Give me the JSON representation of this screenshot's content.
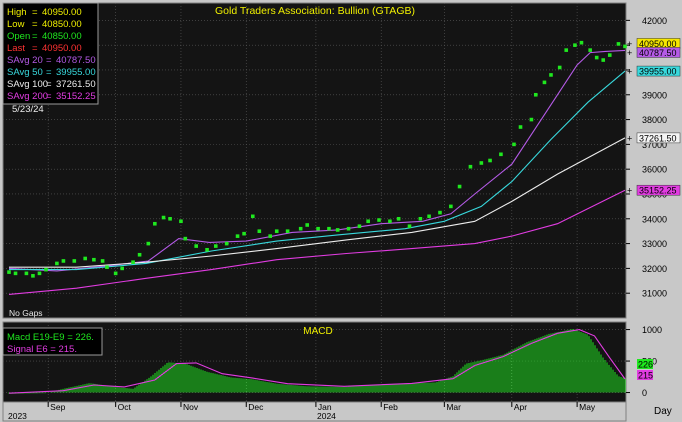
{
  "colors": {
    "background": "#141414",
    "grid": "#5a5a5a",
    "price": "#1fe81f",
    "savg20": "#b45ae6",
    "savg50": "#38d8dc",
    "savg100": "#ececec",
    "savg200": "#e13ce1",
    "high": "#f0f000",
    "low": "#f0f000",
    "open": "#1fe81f",
    "last": "#ff3232",
    "macd_bars": "#1fe81f",
    "signal": "#e13ce1",
    "title": "#f0f000",
    "last_badge": "#f5e600"
  },
  "main": {
    "title": "Gold Traders Association: Bullion (GTAGB)",
    "no_gaps": "No Gaps",
    "legend": {
      "high_label": "High",
      "high_value": "40950.00",
      "low_label": "Low",
      "low_value": "40850.00",
      "open_label": "Open",
      "open_value": "40850.00",
      "last_label": "Last",
      "last_value": "40950.00",
      "s20_label": "SAvg  20",
      "s20_value": "40787.50",
      "s50_label": "SAvg  50",
      "s50_value": "39955.00",
      "s100_label": "SAvg 100",
      "s100_value": "37261.50",
      "s200_label": "SAvg 200",
      "s200_value": "35152.25",
      "date": "5/23/24"
    },
    "badges": {
      "last": "40950.00",
      "s20": "40787.50",
      "s50": "39955.00",
      "s100": "37261.50",
      "s200": "35152.25"
    }
  },
  "macd": {
    "title": "MACD",
    "legend_macd": "Macd  E19-E9  =  226.",
    "legend_signal": "Signal  E6  =  215.",
    "badge_macd": "226",
    "badge_signal": "215"
  },
  "x_axis": {
    "year_2023": "2023",
    "year_2024": "2024",
    "months": [
      "Sep",
      "Oct",
      "Nov",
      "Dec",
      "Jan",
      "Feb",
      "Mar",
      "Apr",
      "May"
    ],
    "period": "Day"
  },
  "chart_data": [
    {
      "type": "line",
      "title": "Gold Traders Association: Bullion (GTAGB)",
      "ylim": [
        30000,
        42700
      ],
      "y_ticks": [
        31000,
        32000,
        33000,
        34000,
        35000,
        36000,
        37000,
        38000,
        39000,
        40000,
        41000,
        42000
      ],
      "x_range": [
        "2023-08-14",
        "2024-05-23"
      ],
      "month_ticks": [
        {
          "label": "Sep",
          "date": "2023-09-01"
        },
        {
          "label": "Oct",
          "date": "2023-10-02"
        },
        {
          "label": "Nov",
          "date": "2023-11-01"
        },
        {
          "label": "Dec",
          "date": "2023-12-01"
        },
        {
          "label": "Jan",
          "date": "2024-01-02"
        },
        {
          "label": "Feb",
          "date": "2024-02-01"
        },
        {
          "label": "Mar",
          "date": "2024-03-01"
        },
        {
          "label": "Apr",
          "date": "2024-04-01"
        },
        {
          "label": "May",
          "date": "2024-05-01"
        }
      ],
      "series": [
        {
          "name": "Price",
          "style": "points",
          "points": [
            [
              "2023-08-14",
              31850
            ],
            [
              "2023-08-17",
              31800
            ],
            [
              "2023-08-22",
              31800
            ],
            [
              "2023-08-25",
              31700
            ],
            [
              "2023-08-28",
              31800
            ],
            [
              "2023-08-31",
              31950
            ],
            [
              "2023-09-05",
              32200
            ],
            [
              "2023-09-08",
              32300
            ],
            [
              "2023-09-13",
              32300
            ],
            [
              "2023-09-18",
              32400
            ],
            [
              "2023-09-22",
              32350
            ],
            [
              "2023-09-26",
              32300
            ],
            [
              "2023-09-28",
              32050
            ],
            [
              "2023-10-02",
              31800
            ],
            [
              "2023-10-05",
              32000
            ],
            [
              "2023-10-10",
              32250
            ],
            [
              "2023-10-13",
              32550
            ],
            [
              "2023-10-17",
              33000
            ],
            [
              "2023-10-20",
              33800
            ],
            [
              "2023-10-24",
              34050
            ],
            [
              "2023-10-27",
              34000
            ],
            [
              "2023-11-01",
              33900
            ],
            [
              "2023-11-03",
              33200
            ],
            [
              "2023-11-08",
              32900
            ],
            [
              "2023-11-13",
              32750
            ],
            [
              "2023-11-17",
              32900
            ],
            [
              "2023-11-22",
              33000
            ],
            [
              "2023-11-27",
              33300
            ],
            [
              "2023-11-30",
              33400
            ],
            [
              "2023-12-04",
              34100
            ],
            [
              "2023-12-07",
              33500
            ],
            [
              "2023-12-12",
              33300
            ],
            [
              "2023-12-15",
              33500
            ],
            [
              "2023-12-20",
              33500
            ],
            [
              "2023-12-26",
              33600
            ],
            [
              "2023-12-29",
              33750
            ],
            [
              "2024-01-03",
              33600
            ],
            [
              "2024-01-08",
              33600
            ],
            [
              "2024-01-12",
              33550
            ],
            [
              "2024-01-17",
              33600
            ],
            [
              "2024-01-22",
              33700
            ],
            [
              "2024-01-26",
              33900
            ],
            [
              "2024-01-31",
              33950
            ],
            [
              "2024-02-05",
              33900
            ],
            [
              "2024-02-09",
              34000
            ],
            [
              "2024-02-14",
              33700
            ],
            [
              "2024-02-19",
              34000
            ],
            [
              "2024-02-23",
              34100
            ],
            [
              "2024-02-28",
              34250
            ],
            [
              "2024-03-04",
              34500
            ],
            [
              "2024-03-08",
              35300
            ],
            [
              "2024-03-13",
              36100
            ],
            [
              "2024-03-18",
              36250
            ],
            [
              "2024-03-22",
              36350
            ],
            [
              "2024-03-27",
              36600
            ],
            [
              "2024-04-02",
              37000
            ],
            [
              "2024-04-05",
              37700
            ],
            [
              "2024-04-10",
              38000
            ],
            [
              "2024-04-12",
              39000
            ],
            [
              "2024-04-16",
              39500
            ],
            [
              "2024-04-19",
              39800
            ],
            [
              "2024-04-23",
              40100
            ],
            [
              "2024-04-26",
              40800
            ],
            [
              "2024-04-30",
              41000
            ],
            [
              "2024-05-03",
              41100
            ],
            [
              "2024-05-07",
              40800
            ],
            [
              "2024-05-10",
              40500
            ],
            [
              "2024-05-13",
              40400
            ],
            [
              "2024-05-16",
              40600
            ],
            [
              "2024-05-20",
              41050
            ],
            [
              "2024-05-23",
              40950
            ]
          ]
        },
        {
          "name": "SAvg 20",
          "points": [
            [
              "2023-08-14",
              32000
            ],
            [
              "2023-09-05",
              31900
            ],
            [
              "2023-09-28",
              32100
            ],
            [
              "2023-10-17",
              32300
            ],
            [
              "2023-10-31",
              33200
            ],
            [
              "2023-11-14",
              33050
            ],
            [
              "2023-12-01",
              33100
            ],
            [
              "2023-12-22",
              33450
            ],
            [
              "2024-01-12",
              33550
            ],
            [
              "2024-02-01",
              33800
            ],
            [
              "2024-02-20",
              33900
            ],
            [
              "2024-03-04",
              34200
            ],
            [
              "2024-03-15",
              35000
            ],
            [
              "2024-04-01",
              36200
            ],
            [
              "2024-04-19",
              38600
            ],
            [
              "2024-05-01",
              40200
            ],
            [
              "2024-05-07",
              40700
            ],
            [
              "2024-05-14",
              40750
            ],
            [
              "2024-05-23",
              40787.5
            ]
          ]
        },
        {
          "name": "SAvg 50",
          "points": [
            [
              "2023-08-14",
              31950
            ],
            [
              "2023-09-14",
              31950
            ],
            [
              "2023-10-16",
              32200
            ],
            [
              "2023-11-15",
              32700
            ],
            [
              "2023-12-15",
              33100
            ],
            [
              "2024-01-12",
              33350
            ],
            [
              "2024-02-12",
              33600
            ],
            [
              "2024-03-01",
              33900
            ],
            [
              "2024-03-18",
              34500
            ],
            [
              "2024-04-01",
              35500
            ],
            [
              "2024-04-19",
              37200
            ],
            [
              "2024-05-06",
              38700
            ],
            [
              "2024-05-23",
              39955
            ]
          ]
        },
        {
          "name": "SAvg 100",
          "points": [
            [
              "2023-08-14",
              32050
            ],
            [
              "2023-09-14",
              32050
            ],
            [
              "2023-10-16",
              32250
            ],
            [
              "2023-11-15",
              32500
            ],
            [
              "2023-12-15",
              32800
            ],
            [
              "2024-01-16",
              33150
            ],
            [
              "2024-02-15",
              33450
            ],
            [
              "2024-03-15",
              33900
            ],
            [
              "2024-04-01",
              34700
            ],
            [
              "2024-04-22",
              35800
            ],
            [
              "2024-05-23",
              37261.5
            ]
          ]
        },
        {
          "name": "SAvg 200",
          "points": [
            [
              "2023-08-14",
              30950
            ],
            [
              "2023-09-14",
              31200
            ],
            [
              "2023-10-16",
              31600
            ],
            [
              "2023-11-15",
              31950
            ],
            [
              "2023-12-15",
              32350
            ],
            [
              "2024-01-16",
              32600
            ],
            [
              "2024-02-15",
              32800
            ],
            [
              "2024-03-15",
              33000
            ],
            [
              "2024-04-01",
              33300
            ],
            [
              "2024-04-22",
              33800
            ],
            [
              "2024-05-23",
              35152.25
            ]
          ]
        }
      ]
    },
    {
      "type": "bar",
      "title": "MACD",
      "ylim": [
        -150,
        1120
      ],
      "y_ticks": [
        0,
        500,
        1000
      ],
      "x_range": [
        "2023-08-14",
        "2024-05-23"
      ],
      "series": [
        {
          "name": "Macd E19-E9",
          "style": "bars",
          "points": [
            [
              "2023-08-14",
              -20
            ],
            [
              "2023-08-31",
              -10
            ],
            [
              "2023-09-08",
              60
            ],
            [
              "2023-09-20",
              150
            ],
            [
              "2023-10-04",
              80
            ],
            [
              "2023-10-10",
              60
            ],
            [
              "2023-10-18",
              250
            ],
            [
              "2023-10-26",
              480
            ],
            [
              "2023-11-03",
              460
            ],
            [
              "2023-11-13",
              330
            ],
            [
              "2023-11-24",
              240
            ],
            [
              "2023-12-04",
              210
            ],
            [
              "2023-12-15",
              140
            ],
            [
              "2023-12-29",
              100
            ],
            [
              "2024-01-15",
              90
            ],
            [
              "2024-02-01",
              130
            ],
            [
              "2024-02-15",
              150
            ],
            [
              "2024-02-26",
              160
            ],
            [
              "2024-03-05",
              260
            ],
            [
              "2024-03-11",
              460
            ],
            [
              "2024-03-19",
              520
            ],
            [
              "2024-03-28",
              600
            ],
            [
              "2024-04-08",
              800
            ],
            [
              "2024-04-18",
              930
            ],
            [
              "2024-04-29",
              1010
            ],
            [
              "2024-05-06",
              920
            ],
            [
              "2024-05-13",
              550
            ],
            [
              "2024-05-20",
              260
            ],
            [
              "2024-05-23",
              226
            ]
          ]
        },
        {
          "name": "Signal E6",
          "points": [
            [
              "2023-08-14",
              -10
            ],
            [
              "2023-09-08",
              30
            ],
            [
              "2023-09-22",
              120
            ],
            [
              "2023-10-06",
              90
            ],
            [
              "2023-10-20",
              200
            ],
            [
              "2023-10-30",
              460
            ],
            [
              "2023-11-08",
              470
            ],
            [
              "2023-11-20",
              300
            ],
            [
              "2023-12-04",
              230
            ],
            [
              "2023-12-20",
              140
            ],
            [
              "2024-01-15",
              100
            ],
            [
              "2024-02-15",
              145
            ],
            [
              "2024-03-05",
              220
            ],
            [
              "2024-03-15",
              430
            ],
            [
              "2024-03-28",
              570
            ],
            [
              "2024-04-10",
              780
            ],
            [
              "2024-04-22",
              940
            ],
            [
              "2024-05-02",
              1000
            ],
            [
              "2024-05-09",
              900
            ],
            [
              "2024-05-16",
              550
            ],
            [
              "2024-05-23",
              215
            ]
          ]
        }
      ]
    }
  ]
}
